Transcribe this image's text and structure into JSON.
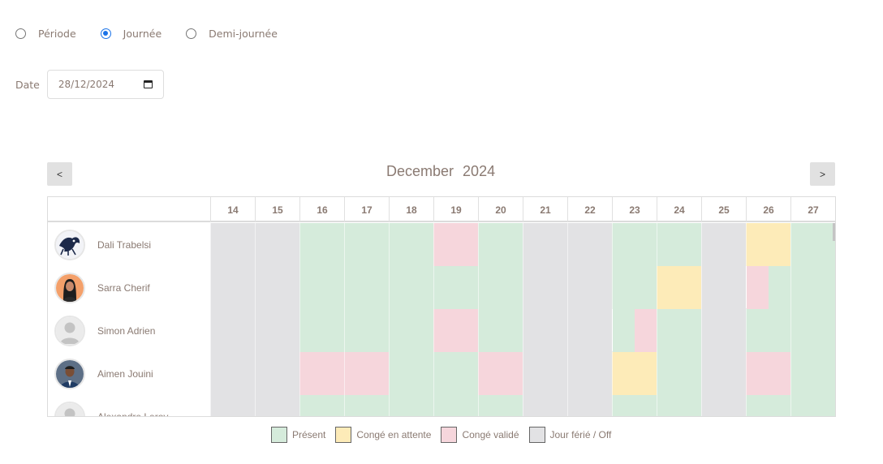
{
  "mode": {
    "options": [
      {
        "label": "Période",
        "checked": false
      },
      {
        "label": "Journée",
        "checked": true
      },
      {
        "label": "Demi-journée",
        "checked": false
      }
    ]
  },
  "date_filter": {
    "label": "Date",
    "value": "28/12/2024",
    "icon": "calendar-icon"
  },
  "calendar": {
    "prev_label": "<",
    "next_label": ">",
    "month": "December",
    "year": "2024",
    "title": "December 2024",
    "days": [
      "14",
      "15",
      "16",
      "17",
      "18",
      "19",
      "20",
      "21",
      "22",
      "23",
      "24",
      "25",
      "26",
      "27"
    ]
  },
  "colors": {
    "present": "#d5ebdb",
    "pending": "#fdebb8",
    "validated": "#f6d6dc",
    "off": "#e2e2e4"
  },
  "employees": [
    {
      "name": "Dali Trabelsi",
      "avatar": "avatar-bird",
      "days": [
        "off",
        "off",
        "present",
        "present",
        "present",
        "validated",
        "present",
        "off",
        "off",
        "present",
        "present",
        "off",
        "pending",
        "present"
      ]
    },
    {
      "name": "Sarra Cherif",
      "avatar": "avatar-woman",
      "days": [
        "off",
        "off",
        "present",
        "present",
        "present",
        "present",
        "present",
        "off",
        "off",
        "present",
        "pending",
        "off",
        "validated|present",
        "present"
      ]
    },
    {
      "name": "Simon Adrien",
      "avatar": "avatar-default",
      "days": [
        "off",
        "off",
        "present",
        "present",
        "present",
        "validated",
        "present",
        "off",
        "off",
        "present|validated",
        "present",
        "off",
        "present",
        "present"
      ]
    },
    {
      "name": "Aimen Jouini",
      "avatar": "avatar-man",
      "days": [
        "off",
        "off",
        "validated",
        "validated",
        "present",
        "present",
        "validated",
        "off",
        "off",
        "pending",
        "present",
        "off",
        "validated",
        "present"
      ]
    },
    {
      "name": "Alexandre Leroy",
      "avatar": "avatar-default",
      "days": [
        "off",
        "off",
        "present",
        "present",
        "present",
        "present",
        "present",
        "off",
        "off",
        "present",
        "present",
        "off",
        "present",
        "present"
      ]
    }
  ],
  "legend": [
    {
      "key": "present",
      "label": "Présent"
    },
    {
      "key": "pending",
      "label": "Congé en attente"
    },
    {
      "key": "validated",
      "label": "Congé validé"
    },
    {
      "key": "off",
      "label": "Jour férié / Off"
    }
  ]
}
